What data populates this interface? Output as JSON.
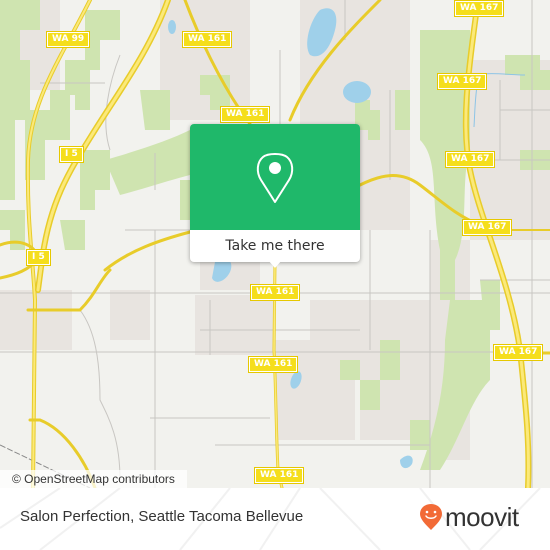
{
  "map": {
    "colors": {
      "background": "#f2f2ee",
      "park": "#cfe4b0",
      "urban": "#e8e4e0",
      "water": "#9fd0ea",
      "highway": "#f5de1c",
      "road": "#c8c6c2",
      "popup_green": "#1fb86a",
      "brand_orange": "#f26a36"
    },
    "route_shields": [
      {
        "label": "WA 99"
      },
      {
        "label": "WA 161"
      },
      {
        "label": "WA 161"
      },
      {
        "label": "I 5"
      },
      {
        "label": "I 5"
      },
      {
        "label": "WA 167"
      },
      {
        "label": "WA 167"
      },
      {
        "label": "WA 167"
      },
      {
        "label": "WA 167"
      },
      {
        "label": "WA 161"
      },
      {
        "label": "WA 161"
      },
      {
        "label": "WA 167"
      },
      {
        "label": "WA 161"
      }
    ],
    "attribution": "© OpenStreetMap contributors"
  },
  "popup": {
    "icon": "map-pin-icon",
    "button_label": "Take me there"
  },
  "footer": {
    "place_name": "Salon Perfection, Seattle Tacoma Bellevue",
    "logo_text": "moovit",
    "logo_icon": "moovit-smiley-pin-icon"
  }
}
